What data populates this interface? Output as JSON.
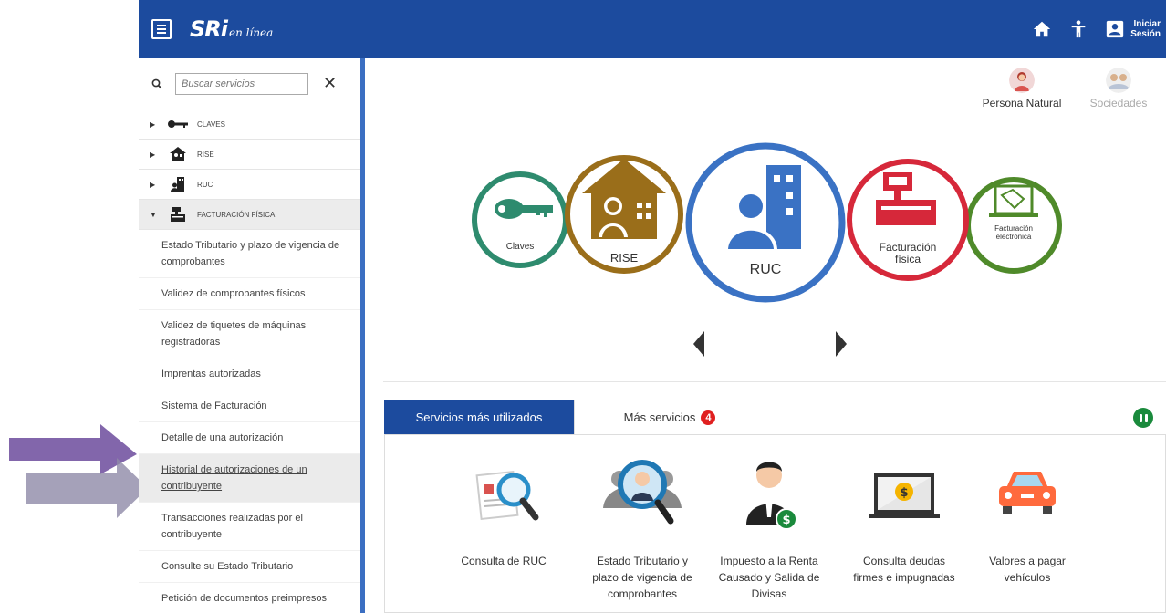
{
  "header": {
    "logo_main": "SRi",
    "logo_sub": "en línea",
    "login_line1": "Iniciar",
    "login_line2": "Sesión"
  },
  "sidebar": {
    "search_placeholder": "Buscar servicios",
    "categories": [
      {
        "label": "CLAVES",
        "icon": "key-icon"
      },
      {
        "label": "RISE",
        "icon": "house-icon"
      },
      {
        "label": "RUC",
        "icon": "building-icon"
      },
      {
        "label": "FACTURACIÓN FÍSICA",
        "icon": "cash-register-icon",
        "expanded": true
      }
    ],
    "items": [
      "Estado Tributario y plazo de vigencia de comprobantes",
      "Validez de comprobantes físicos",
      "Validez de tiquetes de máquinas registradoras",
      "Imprentas autorizadas",
      "Sistema de Facturación",
      "Detalle de una autorización",
      "Historial de autorizaciones de un contribuyente",
      "Transacciones realizadas por el contribuyente",
      "Consulte su Estado Tributario",
      "Petición de documentos preimpresos"
    ],
    "active_item": "Historial de autorizaciones de un contribuyente"
  },
  "personas": [
    {
      "label": "Persona Natural",
      "active": true
    },
    {
      "label": "Sociedades",
      "active": false
    }
  ],
  "carousel": {
    "items": [
      {
        "label": "Claves",
        "color": "#2e8b6e"
      },
      {
        "label": "RISE",
        "color": "#9a6e1a"
      },
      {
        "label": "RUC",
        "color": "#3a72c4"
      },
      {
        "label": "Facturación física",
        "color": "#d6283a"
      },
      {
        "label": "Facturación electrónica",
        "color": "#4f8a2a"
      }
    ]
  },
  "tabs": {
    "active_label": "Servicios más utilizados",
    "other_label": "Más servicios",
    "badge_count": "4"
  },
  "services": [
    {
      "label": "Consulta de RUC",
      "icon": "document-search-icon"
    },
    {
      "label": "Estado Tributario y plazo de vigencia de comprobantes",
      "icon": "person-search-icon"
    },
    {
      "label": "Impuesto a la Renta Causado y Salida de Divisas",
      "icon": "businessman-money-icon"
    },
    {
      "label": "Consulta deudas firmes e impugnadas",
      "icon": "laptop-money-icon"
    },
    {
      "label": "Valores a pagar vehículos",
      "icon": "car-icon"
    }
  ],
  "colors": {
    "header_blue": "#1c4b9e",
    "accent_purple": "#7b5ea7"
  }
}
